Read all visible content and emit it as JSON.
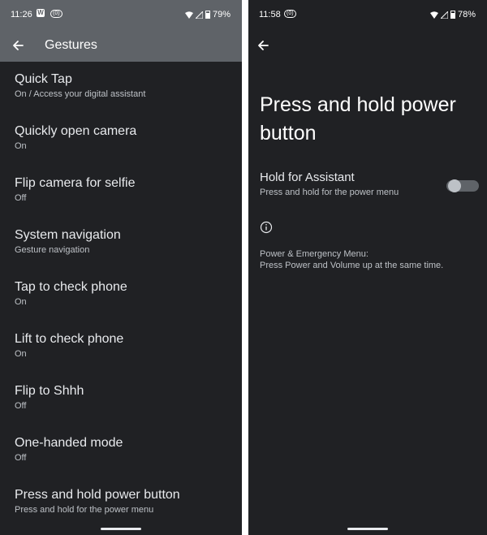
{
  "left_screen": {
    "status": {
      "time": "11:26",
      "app_icon_letter": "W",
      "cast_label": "(0)",
      "battery": "79%"
    },
    "app_bar": {
      "title": "Gestures"
    },
    "items": [
      {
        "title": "Quick Tap",
        "summary": "On / Access your digital assistant"
      },
      {
        "title": "Quickly open camera",
        "summary": "On"
      },
      {
        "title": "Flip camera for selfie",
        "summary": "Off"
      },
      {
        "title": "System navigation",
        "summary": "Gesture navigation"
      },
      {
        "title": "Tap to check phone",
        "summary": "On"
      },
      {
        "title": "Lift to check phone",
        "summary": "On"
      },
      {
        "title": "Flip to Shhh",
        "summary": "Off"
      },
      {
        "title": "One-handed mode",
        "summary": "Off"
      },
      {
        "title": "Press and hold power button",
        "summary": "Press and hold for the power menu"
      }
    ]
  },
  "right_screen": {
    "status": {
      "time": "11:58",
      "cast_label": "(0)",
      "battery": "78%"
    },
    "heading": "Press and hold power button",
    "hold_setting": {
      "title": "Hold for Assistant",
      "summary": "Press and hold for the power menu",
      "enabled": false
    },
    "footer": {
      "line1": "Power & Emergency Menu:",
      "line2": "Press Power and Volume up at the same time."
    }
  },
  "colors": {
    "background": "#202124",
    "app_bar": "#5f6368",
    "primary_text": "#e8eaed",
    "secondary_text": "#bdc1c6"
  },
  "icons": [
    "back-arrow-icon",
    "wifi-icon",
    "signal-icon",
    "battery-icon",
    "info-icon",
    "toggle-switch"
  ]
}
